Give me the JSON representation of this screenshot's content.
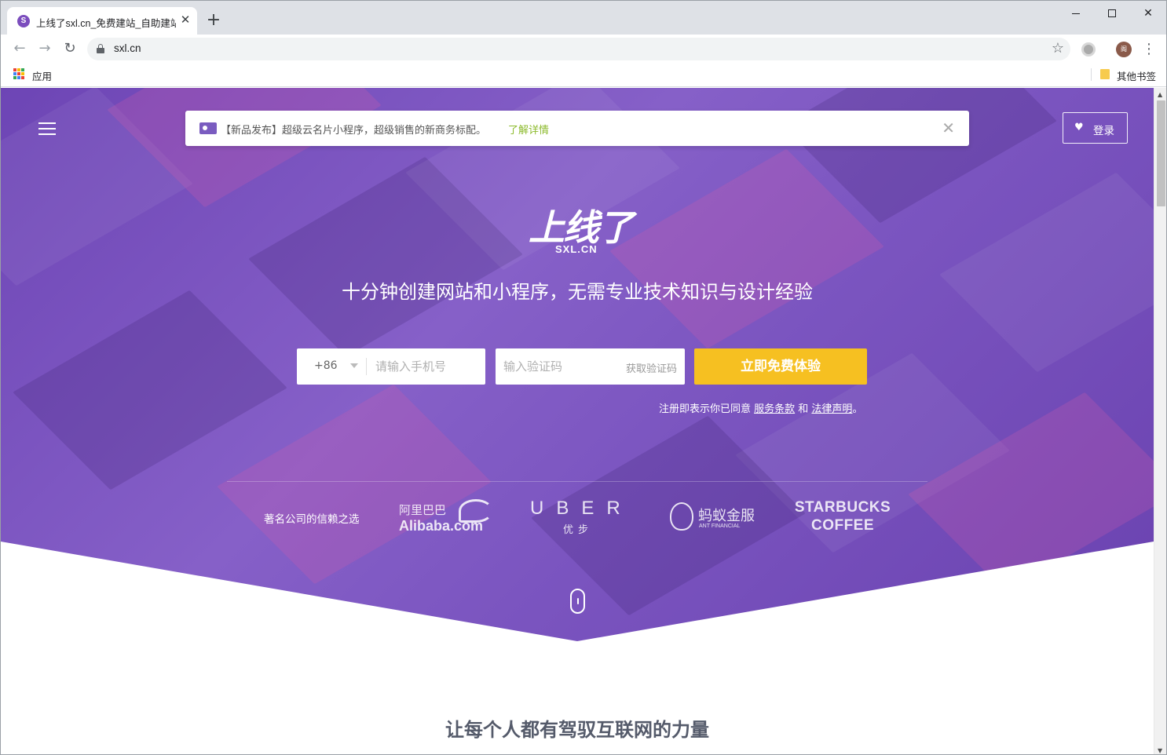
{
  "browser": {
    "tab_title": "上线了sxl.cn_免费建站_自助建站",
    "tab_favicon_letter": "S",
    "url": "sxl.cn",
    "bookmarks_apps_label": "应用",
    "bookmarks_other_label": "其他书签",
    "avatar_initial": "阁"
  },
  "notice": {
    "text": "【新品发布】超级云名片小程序，超级销售的新商务标配。",
    "link": "了解详情"
  },
  "header": {
    "login_label": "登录"
  },
  "hero": {
    "logo_main": "上线了",
    "logo_sub": "SXL.CN",
    "tagline": "十分钟创建网站和小程序，无需专业技术知识与设计经验",
    "country_code": "+86",
    "phone_placeholder": "请输入手机号",
    "code_placeholder": "输入验证码",
    "get_code_label": "获取验证码",
    "cta_label": "立即免费体验",
    "terms_prefix": "注册即表示你已同意 ",
    "terms_service": "服务条款",
    "terms_and": " 和 ",
    "terms_legal": "法律声明",
    "terms_suffix": "。"
  },
  "trusted": {
    "label": "著名公司的信赖之选",
    "alibaba_cn": "阿里巴巴",
    "alibaba_en": "Alibaba.com",
    "uber_en": "UBER",
    "uber_cn": "优步",
    "ant_cn": "蚂蚁金服",
    "ant_en": "ANT FINANCIAL",
    "starbucks_line1": "STARBUCKS",
    "starbucks_line2": "COFFEE"
  },
  "section": {
    "title": "让每个人都有驾驭互联网的力量"
  },
  "colors": {
    "hero_purple": "#7b55c0",
    "cta_yellow": "#f6c021",
    "notice_link_green": "#8cba2c",
    "section_title": "#545a6a"
  }
}
